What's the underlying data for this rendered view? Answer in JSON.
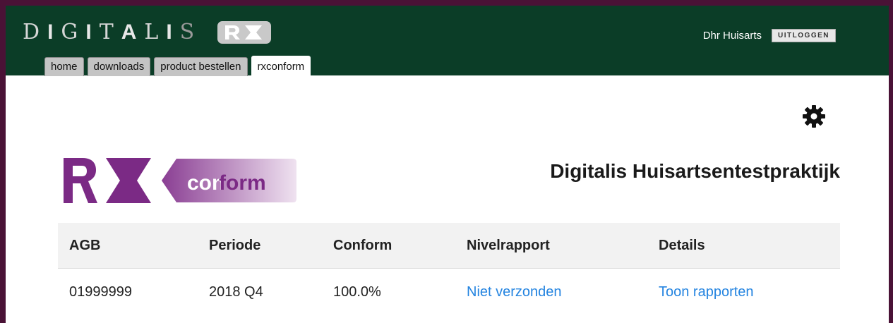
{
  "header": {
    "logo_letters": [
      "D",
      "I",
      "G",
      "I",
      "T",
      "A",
      "L",
      "I",
      "S"
    ],
    "logo_badge": "RX",
    "user_name": "Dhr Huisarts",
    "logout_label": "UITLOGGEN"
  },
  "tabs": [
    {
      "label": "home",
      "active": false
    },
    {
      "label": "downloads",
      "active": false
    },
    {
      "label": "product bestellen",
      "active": false
    },
    {
      "label": "rxconform",
      "active": true
    }
  ],
  "main": {
    "settings_icon": "gear-icon",
    "brand_logo": {
      "rx": "RX",
      "word_a": "con",
      "word_b": "form"
    },
    "practice_title": "Digitalis Huisartsentestpraktijk",
    "table": {
      "headers": [
        "AGB",
        "Periode",
        "Conform",
        "Nivelrapport",
        "Details"
      ],
      "rows": [
        {
          "agb": "01999999",
          "periode": "2018 Q4",
          "conform": "100.0%",
          "nivelrapport": "Niet verzonden",
          "details": "Toon rapporten"
        }
      ]
    }
  },
  "colors": {
    "header_bg": "#0b3d27",
    "border": "#4a1236",
    "brand_purple": "#7b2a85",
    "link": "#2484e0"
  }
}
